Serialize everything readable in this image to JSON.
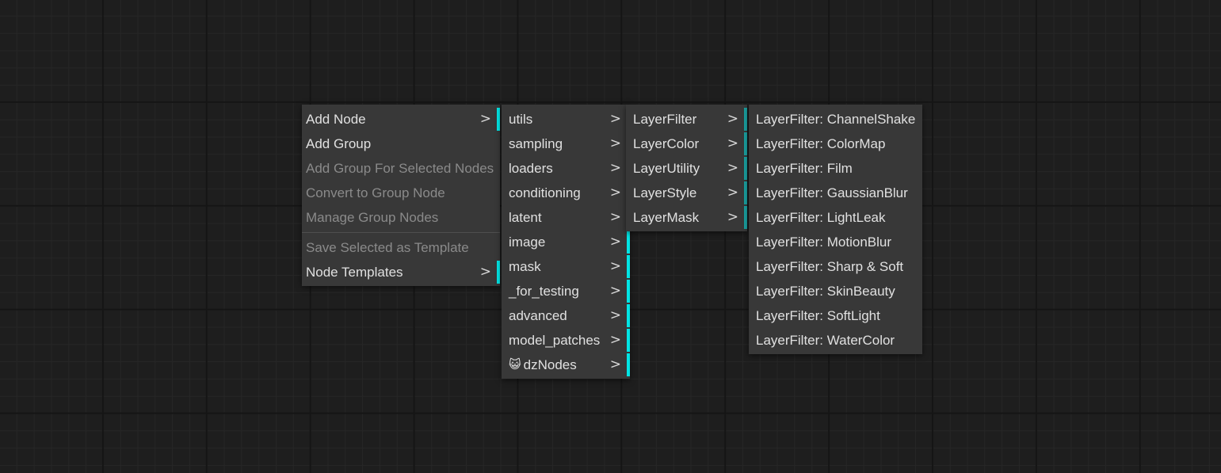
{
  "app": {
    "canvas_background": "#1e1e1e",
    "grid_minor_color": "#262626",
    "grid_major_color": "#151515",
    "menu_background": "#383838",
    "accent_color": "#00e5e5",
    "accent_dim_color": "#1a9e9e",
    "text_color": "#e0e0e0",
    "disabled_text_color": "#8a8a8a"
  },
  "menus": {
    "root": {
      "name": "canvas-context-menu",
      "items": [
        {
          "label": "Add Node",
          "submenu": true,
          "disabled": false,
          "accent": "bright"
        },
        {
          "label": "Add Group",
          "submenu": false,
          "disabled": false
        },
        {
          "label": "Add Group For Selected Nodes",
          "submenu": false,
          "disabled": true
        },
        {
          "label": "Convert to Group Node",
          "submenu": false,
          "disabled": true
        },
        {
          "label": "Manage Group Nodes",
          "submenu": false,
          "disabled": true
        },
        {
          "separator": true
        },
        {
          "label": "Save Selected as Template",
          "submenu": false,
          "disabled": true
        },
        {
          "label": "Node Templates",
          "submenu": true,
          "disabled": false,
          "accent": "bright"
        }
      ]
    },
    "add_node": {
      "name": "add-node-submenu",
      "items": [
        {
          "label": "utils",
          "submenu": true,
          "accent": "dim"
        },
        {
          "label": "sampling",
          "submenu": true,
          "accent": "dim"
        },
        {
          "label": "loaders",
          "submenu": true,
          "accent": "dim"
        },
        {
          "label": "conditioning",
          "submenu": true,
          "accent": "dim"
        },
        {
          "label": "latent",
          "submenu": true,
          "accent": "dim"
        },
        {
          "label": "image",
          "submenu": true,
          "accent": "bright"
        },
        {
          "label": "mask",
          "submenu": true,
          "accent": "bright"
        },
        {
          "label": "_for_testing",
          "submenu": true,
          "accent": "bright"
        },
        {
          "label": "advanced",
          "submenu": true,
          "accent": "bright"
        },
        {
          "label": "model_patches",
          "submenu": true,
          "accent": "bright"
        },
        {
          "label": "dzNodes",
          "icon": "cat-emoji-icon",
          "glyph": "😺",
          "submenu": true,
          "accent": "bright"
        }
      ]
    },
    "dznodes": {
      "name": "dznodes-submenu",
      "items": [
        {
          "label": "LayerFilter",
          "submenu": true,
          "accent": "dim"
        },
        {
          "label": "LayerColor",
          "submenu": true,
          "accent": "dim"
        },
        {
          "label": "LayerUtility",
          "submenu": true,
          "accent": "dim"
        },
        {
          "label": "LayerStyle",
          "submenu": true,
          "accent": "dim"
        },
        {
          "label": "LayerMask",
          "submenu": true,
          "accent": "dim"
        }
      ]
    },
    "layerfilter": {
      "name": "layerfilter-submenu",
      "items": [
        {
          "label": "LayerFilter: ChannelShake",
          "submenu": false
        },
        {
          "label": "LayerFilter: ColorMap",
          "submenu": false
        },
        {
          "label": "LayerFilter: Film",
          "submenu": false
        },
        {
          "label": "LayerFilter: GaussianBlur",
          "submenu": false
        },
        {
          "label": "LayerFilter: LightLeak",
          "submenu": false
        },
        {
          "label": "LayerFilter: MotionBlur",
          "submenu": false
        },
        {
          "label": "LayerFilter: Sharp & Soft",
          "submenu": false
        },
        {
          "label": "LayerFilter: SkinBeauty",
          "submenu": false
        },
        {
          "label": "LayerFilter: SoftLight",
          "submenu": false
        },
        {
          "label": "LayerFilter: WaterColor",
          "submenu": false
        }
      ]
    }
  },
  "icons": {
    "submenu_arrow": ">"
  }
}
